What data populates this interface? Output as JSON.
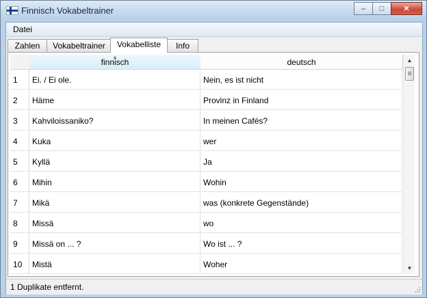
{
  "window": {
    "title": "Finnisch Vokabeltrainer",
    "controls": {
      "minimize": "–",
      "maximize": "□",
      "close": "✕"
    }
  },
  "menu": {
    "items": [
      "Datei"
    ]
  },
  "tabs": [
    {
      "label": "Zahlen",
      "active": false
    },
    {
      "label": "Vokabeltrainer",
      "active": false
    },
    {
      "label": "Vokabelliste",
      "active": true
    },
    {
      "label": "Info",
      "active": false
    }
  ],
  "table": {
    "columns": [
      "finnisch",
      "deutsch"
    ],
    "sorted_column": "finnisch",
    "rows": [
      {
        "num": "1",
        "finnisch": "Ei. / Ei ole.",
        "deutsch": "Nein, es ist nicht"
      },
      {
        "num": "2",
        "finnisch": "Häme",
        "deutsch": "Provinz in Finland"
      },
      {
        "num": "3",
        "finnisch": "Kahviloissaniko?",
        "deutsch": "In meinen Cafés?"
      },
      {
        "num": "4",
        "finnisch": "Kuka",
        "deutsch": "wer"
      },
      {
        "num": "5",
        "finnisch": "Kyllä",
        "deutsch": "Ja"
      },
      {
        "num": "6",
        "finnisch": "Mihin",
        "deutsch": "Wohin"
      },
      {
        "num": "7",
        "finnisch": "Mikä",
        "deutsch": "was (konkrete Gegenstände)"
      },
      {
        "num": "8",
        "finnisch": "Missä",
        "deutsch": "wo"
      },
      {
        "num": "9",
        "finnisch": "Missä on ... ?",
        "deutsch": "Wo ist ... ?"
      },
      {
        "num": "10",
        "finnisch": "Mistä",
        "deutsch": "Woher"
      }
    ]
  },
  "status": {
    "text": "1 Duplikate entfernt."
  },
  "colors": {
    "close_button": "#c9483a",
    "title_bar": "#c7daf0",
    "sorted_header": "#d9eefa"
  }
}
